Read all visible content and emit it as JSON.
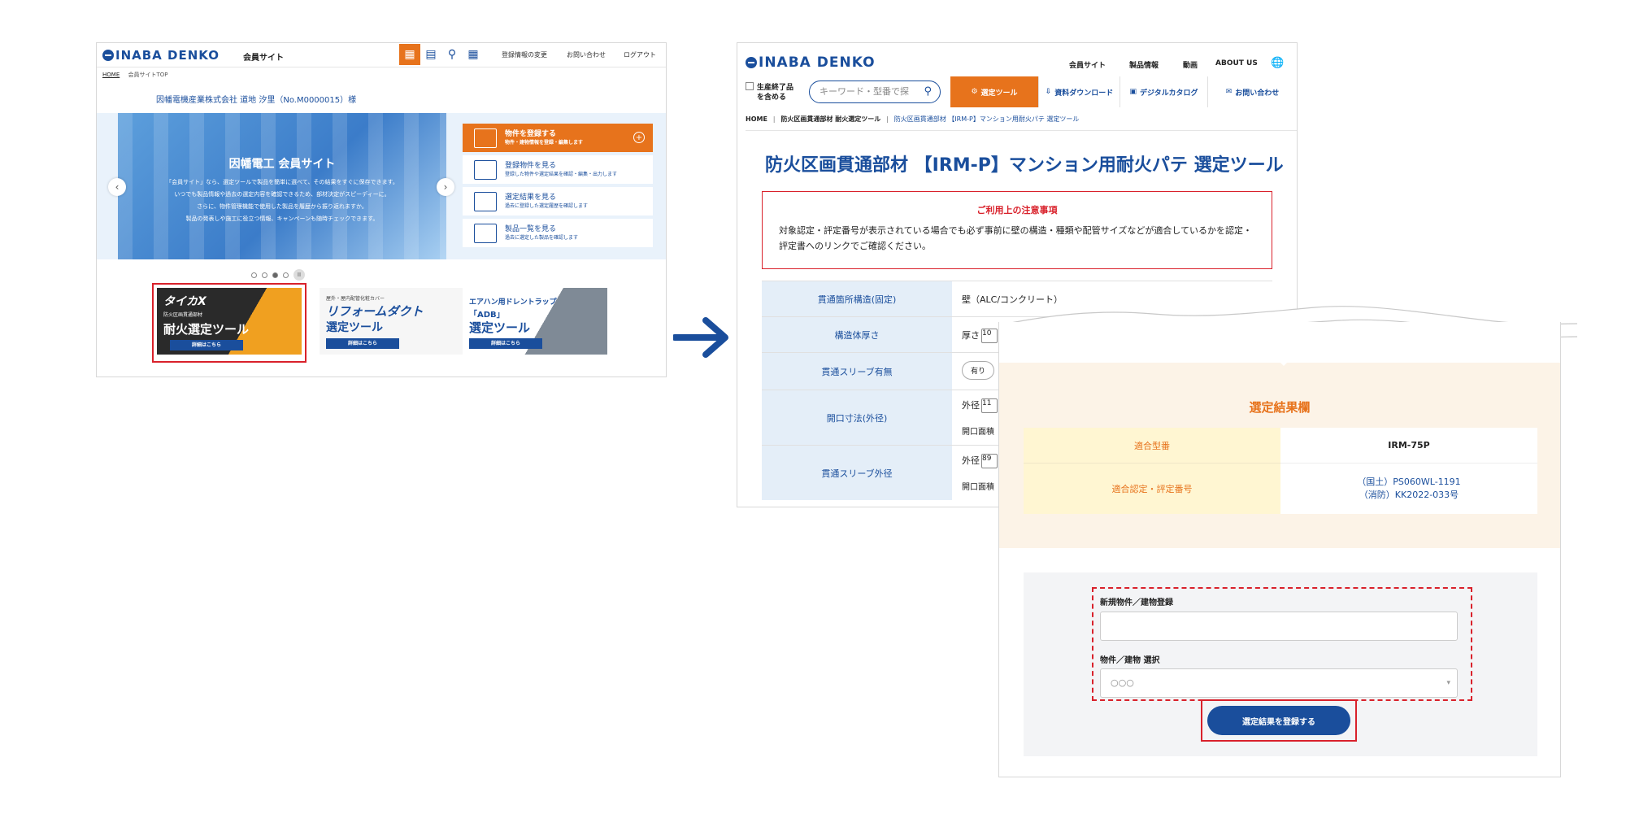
{
  "colors": {
    "brand_blue": "#1a4e9c",
    "accent_orange": "#e7731c",
    "highlight_red": "#d9212b"
  },
  "left": {
    "logo": "INABA DENKO",
    "site_name": "会員サイト",
    "header_icons": [
      "register-icon",
      "document-icon",
      "search-result-icon",
      "product-list-icon"
    ],
    "nav": [
      "登録情報の変更",
      "お問い合わせ",
      "ログアウト"
    ],
    "breadcrumb": {
      "home": "HOME",
      "current": "会員サイトTOP"
    },
    "greeting": "因幡電機産業株式会社 道地 汐里（No.M0000015）様",
    "hero": {
      "title": "因幡電工 会員サイト",
      "lines": [
        "「会員サイト」なら、選定ツールで製品を簡単に選べて、その結果をすぐに保存できます。",
        "いつでも製品情報や過去の選定内容を確認できるため、部材決定がスピーディーに。",
        "さらに、物件管理機能で使用した製品を履歴から振り返れますか。",
        "製品の発表しや施工に役立つ情報、キャンペーンも随時チェックできます。"
      ]
    },
    "menu": [
      {
        "title": "物件を登録する",
        "sub": "物件・建物情報を登録・編集します"
      },
      {
        "title": "登録物件を見る",
        "sub": "登録した物件や選定結果を確認・編集・出力します"
      },
      {
        "title": "選定結果を見る",
        "sub": "過去に登録した選定履歴を確認します"
      },
      {
        "title": "製品一覧を見る",
        "sub": "過去に選定した製品を確認します"
      }
    ],
    "banners": [
      {
        "brand": "タイカX",
        "small": "防火区画貫通部材",
        "main": "耐火選定ツール",
        "btn": "詳細はこちら"
      },
      {
        "small": "屋外・屋内配管化粧カバー",
        "main": "リフォームダクト",
        "main2": "選定ツール",
        "btn": "詳細はこちら"
      },
      {
        "small": "エアハン用ドレントラップ",
        "tag": "「ADB」",
        "main": "選定ツール",
        "btn": "詳細はこちら"
      }
    ]
  },
  "mid": {
    "logo": "INABA DENKO",
    "nav": [
      "会員サイト",
      "製品情報",
      "動画",
      "ABOUT US"
    ],
    "gen_checkbox": [
      "生産終了品",
      "を含める"
    ],
    "search_placeholder": "キーワード・型番で探",
    "tabs": [
      "選定ツール",
      "資料ダウンロード",
      "デジタルカタログ",
      "お問い合わせ"
    ],
    "breadcrumb": [
      "HOME",
      "防火区画貫通部材 耐火選定ツール",
      "防火区画貫通部材 【IRM-P】マンション用耐火パテ 選定ツール"
    ],
    "title": "防火区画貫通部材 【IRM-P】マンション用耐火パテ 選定ツール",
    "notice": {
      "heading": "ご利用上の注意事項",
      "body": "対象認定・評定番号が表示されている場合でも必ず事前に壁の構造・種類や配管サイズなどが適合しているかを認定・評定書へのリンクでご確認ください。"
    },
    "rows": [
      {
        "label": "貫通箇所構造(固定)",
        "value": "壁（ALC/コンクリート）"
      },
      {
        "label": "構造体厚さ",
        "value": "厚さ",
        "field": "10"
      },
      {
        "label": "貫通スリーブ有無",
        "value": "有り"
      },
      {
        "label": "開口寸法(外径)",
        "value": "外径",
        "field": "11",
        "sub": "開口面積"
      },
      {
        "label": "貫通スリーブ外径",
        "value": "外径",
        "field": "89",
        "sub": "開口面積"
      }
    ]
  },
  "right": {
    "panel_title": "選定結果欄",
    "result": [
      {
        "key": "適合型番",
        "value": "IRM-75P"
      },
      {
        "key": "適合認定・評定番号",
        "value_lines": [
          "（国土）PS060WL-1191",
          "（消防）KK2022-033号"
        ]
      }
    ],
    "form": {
      "new_label": "新規物件／建物登録",
      "select_label": "物件／建物 選択",
      "select_value": "○○○",
      "submit": "選定結果を登録する"
    }
  }
}
